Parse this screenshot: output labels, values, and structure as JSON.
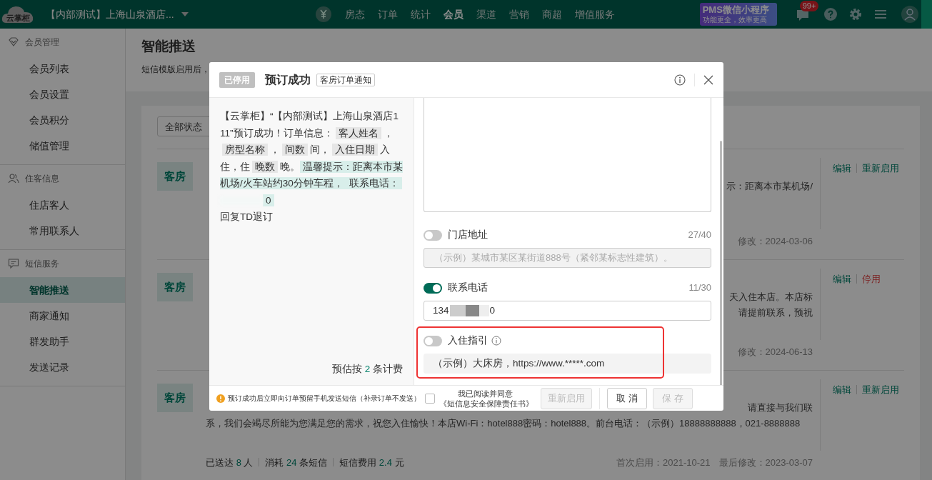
{
  "navbar": {
    "logo": "云掌柜",
    "hotel": "【内部测试】上海山泉酒店...",
    "menu": [
      {
        "label": "房态",
        "selected": false
      },
      {
        "label": "订单",
        "selected": false
      },
      {
        "label": "统计",
        "selected": false
      },
      {
        "label": "会员",
        "selected": true
      },
      {
        "label": "渠道",
        "selected": false
      },
      {
        "label": "营销",
        "selected": false
      },
      {
        "label": "商超",
        "selected": false
      },
      {
        "label": "增值服务",
        "selected": false
      }
    ],
    "promo": {
      "title": "PMS微信小程序",
      "subtitle": "功能更全，效率更高"
    },
    "message_badge": "99+"
  },
  "sidebar": {
    "groups": [
      {
        "title": "会员管理",
        "items": [
          {
            "label": "会员列表",
            "selected": false
          },
          {
            "label": "会员设置",
            "selected": false
          },
          {
            "label": "会员积分",
            "selected": false
          },
          {
            "label": "储值管理",
            "selected": false
          }
        ]
      },
      {
        "title": "住客信息",
        "items": [
          {
            "label": "住店客人",
            "selected": false
          },
          {
            "label": "常用联系人",
            "selected": false
          }
        ]
      },
      {
        "title": "短信服务",
        "items": [
          {
            "label": "智能推送",
            "selected": true
          },
          {
            "label": "商家通知",
            "selected": false
          },
          {
            "label": "群发助手",
            "selected": false
          },
          {
            "label": "发送记录",
            "selected": false
          }
        ]
      }
    ]
  },
  "page": {
    "title": "智能推送",
    "description": "短信模版启用后，",
    "filter": "全部状态"
  },
  "cards": [
    {
      "tag": "客房",
      "tail_lines": [
        "示：距离本市某机场/"
      ],
      "dates": [
        {
          "text": "修改：2024-03-06"
        }
      ],
      "actions": [
        {
          "label": "编辑",
          "kind": "normal"
        },
        {
          "label": "重新启用",
          "kind": "normal"
        }
      ]
    },
    {
      "tag": "客房",
      "tail_lines": [
        "天入住本店。本店标",
        "请提前联系，预祝"
      ],
      "dates": [
        {
          "text": "修改：2024-06-13"
        }
      ],
      "actions": [
        {
          "label": "编辑",
          "kind": "normal"
        },
        {
          "label": "停用",
          "kind": "danger"
        }
      ]
    },
    {
      "tag": "客房",
      "tail_lines": [
        "请直接与我们联"
      ],
      "lines": [
        "系，我们会竭尽所能为您满足您的需求，祝您入住愉快！本店Wi-Fi：hotel888密码：hotel888。前台电话：（示例）18888888888，021-8888888"
      ],
      "stats": [
        {
          "label": "已送达",
          "value": "8",
          "unit": "人"
        },
        {
          "label": "消耗",
          "value": "24",
          "unit": "条短信"
        },
        {
          "label": "短信费用",
          "value": "2.4",
          "unit": "元"
        }
      ],
      "dates": [
        {
          "text": "首次启用：2021-10-21"
        },
        {
          "text": "最后修改：2023-03-07"
        }
      ],
      "actions": [
        {
          "label": "编辑",
          "kind": "normal"
        },
        {
          "label": "重新启用",
          "kind": "normal"
        }
      ]
    }
  ],
  "modal": {
    "status": "已停用",
    "title": "预订成功",
    "tag": "客房订单通知",
    "preview": [
      {
        "text": "【云掌柜】“【内部测试】上海山泉酒店111”预订成功！订单信息：",
        "kind": "plain"
      },
      {
        "text": "客人姓名",
        "kind": "variable"
      },
      {
        "text": "，",
        "kind": "plain"
      },
      {
        "text": "房型名称",
        "kind": "variable"
      },
      {
        "text": "，",
        "kind": "plain"
      },
      {
        "text": "间数",
        "kind": "variable"
      },
      {
        "text": "间，",
        "kind": "plain"
      },
      {
        "text": "入住日期",
        "kind": "variable"
      },
      {
        "text": "入住，住",
        "kind": "plain"
      },
      {
        "text": "晚数",
        "kind": "variable"
      },
      {
        "text": "晚。",
        "kind": "plain"
      },
      {
        "text": "温馨提示：距离本市某机场/火车站约30分钟车程，",
        "kind": "tip"
      },
      {
        "text": "联系电话：",
        "kind": "tip"
      },
      {
        "kind": "redacted"
      },
      {
        "text": "0",
        "kind": "tip"
      }
    ],
    "preview_footer": "回复TD退订",
    "estimate": {
      "prefix": "预估按",
      "count": "2",
      "suffix": "条计费"
    },
    "options": [
      {
        "label": "门店地址",
        "on": false,
        "count": "27/40",
        "placeholder": "（示例）某城市某区某街道888号（紧邻某标志性建筑）。"
      },
      {
        "label": "联系电话",
        "on": true,
        "count": "11/30",
        "value_start": "134",
        "value_end": "0"
      },
      {
        "label": "入住指引",
        "on": false,
        "value": "（示例）大床房，https://www.*****.com",
        "info": true,
        "highlighted": true
      }
    ],
    "note": "预订成功后立即向订单预留手机发送短信（补录订单不发送）",
    "agree": {
      "checked": false,
      "text": "我已阅读并同意",
      "link": "《短信息安全保障责任书》"
    },
    "buttons": [
      {
        "label": "重新启用",
        "kind": "secondary",
        "disabled": true
      },
      {
        "label": "取 消",
        "kind": "cancel",
        "disabled": false
      },
      {
        "label": "保 存",
        "kind": "primary",
        "disabled": true
      }
    ]
  }
}
